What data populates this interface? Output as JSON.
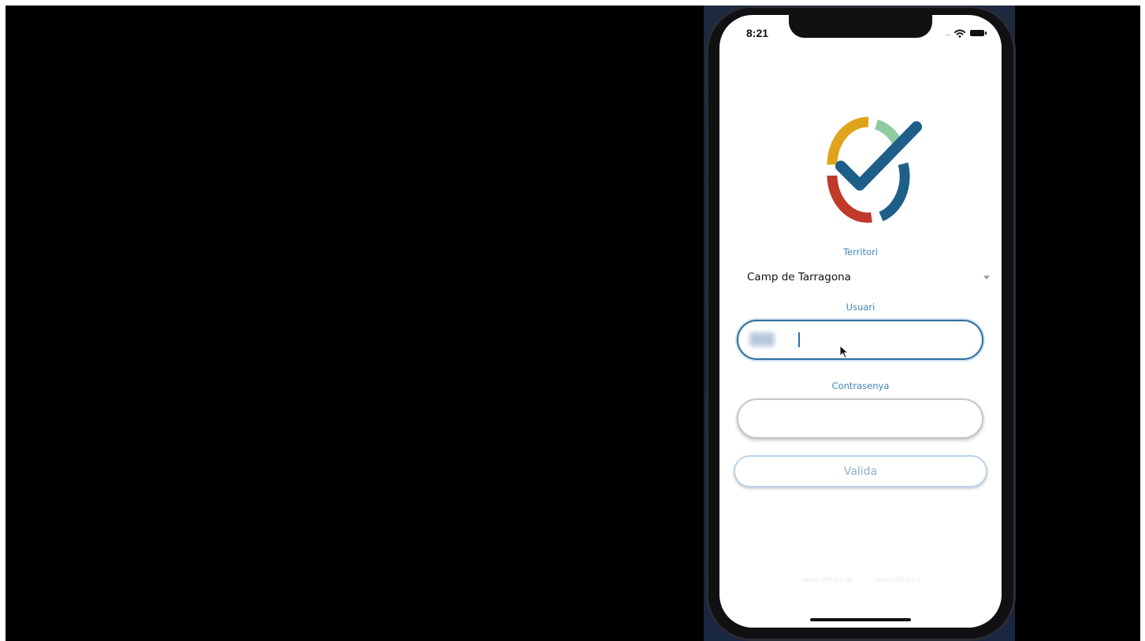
{
  "status_bar": {
    "time": "8:21",
    "signal": "....",
    "icons": [
      "wifi-icon",
      "battery-icon"
    ]
  },
  "brand": {
    "logo_icon": "cycle-checkmark-logo",
    "colors": [
      "#e0a31c",
      "#8fcaa0",
      "#c0392b",
      "#1e5f8a"
    ]
  },
  "form": {
    "territory": {
      "label": "Territori",
      "value": "Camp de Tarragona"
    },
    "user": {
      "label": "Usuari"
    },
    "password": {
      "label": "Contrasenya"
    },
    "submit_label": "Valida",
    "accent_color": "#3e84b8"
  },
  "footer": {
    "app_version": "Versió APP 0.2.16",
    "api_version": "Versió API 1.3.6"
  }
}
